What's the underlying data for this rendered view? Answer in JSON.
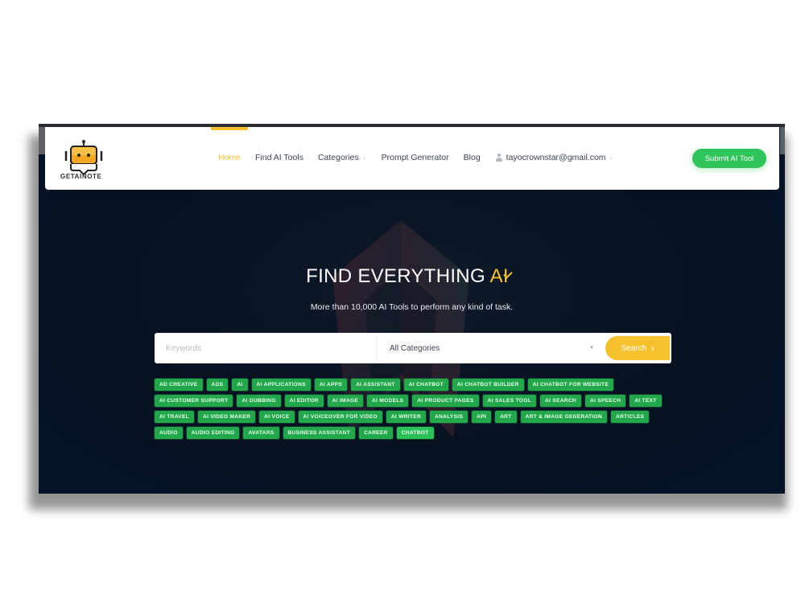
{
  "brand": {
    "name": "GETAINOTE"
  },
  "nav": {
    "links": [
      {
        "label": "Home",
        "active": true,
        "dropdown": false
      },
      {
        "label": "Find AI Tools",
        "active": false,
        "dropdown": false
      },
      {
        "label": "Categories",
        "active": false,
        "dropdown": true
      },
      {
        "label": "Prompt Generator",
        "active": false,
        "dropdown": false
      },
      {
        "label": "Blog",
        "active": false,
        "dropdown": false
      }
    ],
    "user_email": "tayocrownstar@gmail.com",
    "submit_label": "Submit AI Tool"
  },
  "hero": {
    "title_main": "FIND EVERYTHING ",
    "title_accent": "AI",
    "subtitle": "More than 10,000 AI Tools to perform any kind of task."
  },
  "search": {
    "keywords_placeholder": "Keywords",
    "keywords_value": "",
    "category_selected": "All Categories",
    "button_label": "Search"
  },
  "tags": [
    "AD CREATIVE",
    "ADS",
    "AI",
    "AI APPLICATIONS",
    "AI APPS",
    "AI ASSISTANT",
    "AI CHATBOT",
    "AI CHATBOT BUILDER",
    "AI CHATBOT FOR WEBSITE",
    "AI CUSTOMER SUPPORT",
    "AI DUBBING",
    "AI EDITOR",
    "AI IMAGE",
    "AI MODELS",
    "AI PRODUCT PAGES",
    "AI SALES TOOL",
    "AI SEARCH",
    "AI SPEECH",
    "AI TEXT",
    "AI TRAVEL",
    "AI VIDEO MAKER",
    "AI VOICE",
    "AI VOICEOVER FOR VIDEO",
    "AI WRITER",
    "ANALYSIS",
    "API",
    "ART",
    "ART & IMAGE GENERATION",
    "ARTICLES",
    "AUDIO",
    "AUDIO EDITING",
    "AVATARS",
    "BUSINESS ASSISTANT",
    "CAREER",
    "CHATBOT"
  ],
  "colors": {
    "accent_yellow": "#f7c12e",
    "tag_green": "#22a84a",
    "button_green": "#2ec65a",
    "hero_bg": "#07111f"
  }
}
